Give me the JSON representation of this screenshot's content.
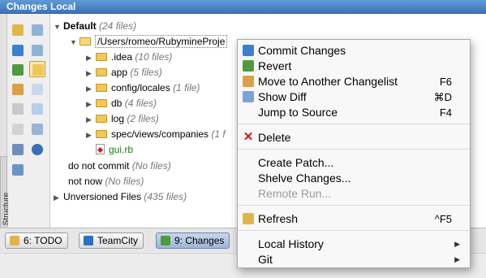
{
  "window": {
    "title": "Changes Local"
  },
  "structure_tab": {
    "label": "2: Structure"
  },
  "tree": {
    "items": [
      {
        "label": "Default",
        "count": "(24 files)"
      },
      {
        "label": "/Users/romeo/RubymineProje",
        "count": ""
      },
      {
        "label": ".idea",
        "count": "(10 files)"
      },
      {
        "label": "app",
        "count": "(5 files)"
      },
      {
        "label": "config/locales",
        "count": "(1 file)"
      },
      {
        "label": "db",
        "count": "(4 files)"
      },
      {
        "label": "log",
        "count": "(2 files)"
      },
      {
        "label": "spec/views/companies",
        "count": "(1 f"
      },
      {
        "label": "gui.rb",
        "count": ""
      },
      {
        "label": "do not commit",
        "count": "(No files)"
      },
      {
        "label": "not now",
        "count": "(No files)"
      },
      {
        "label": "Unversioned Files",
        "count": "(435 files)"
      }
    ]
  },
  "bottom_tabs": [
    {
      "label": "6: TODO"
    },
    {
      "label": "TeamCity"
    },
    {
      "label": "9: Changes"
    }
  ],
  "context_menu": {
    "items": [
      {
        "label": "Commit Changes",
        "shortcut": ""
      },
      {
        "label": "Revert",
        "shortcut": ""
      },
      {
        "label": "Move to Another Changelist",
        "shortcut": "F6"
      },
      {
        "label": "Show Diff",
        "shortcut": "⌘D"
      },
      {
        "label": "Jump to Source",
        "shortcut": "F4"
      },
      {
        "label": "Delete",
        "shortcut": ""
      },
      {
        "label": "Create Patch...",
        "shortcut": ""
      },
      {
        "label": "Shelve Changes...",
        "shortcut": ""
      },
      {
        "label": "Remote Run...",
        "shortcut": ""
      },
      {
        "label": "Refresh",
        "shortcut": "^F5"
      },
      {
        "label": "Local History",
        "shortcut": ""
      },
      {
        "label": "Git",
        "shortcut": ""
      }
    ]
  },
  "colors": {
    "title_bar": "#4a84c6",
    "selected_tool": "#ffe9a8",
    "folder": "#f0c85a",
    "ruby_file_text": "#1d7a1d",
    "delete_icon": "#d21a1a"
  }
}
